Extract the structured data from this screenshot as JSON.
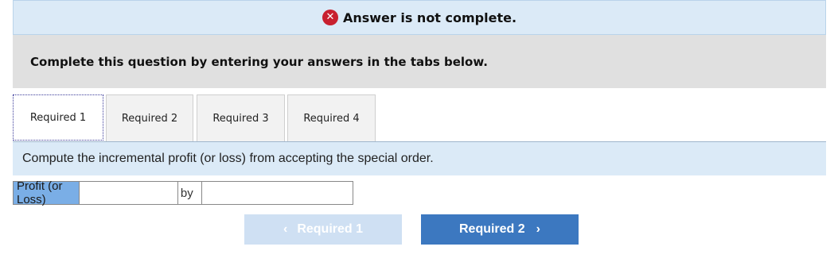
{
  "banner": {
    "icon": "error-x-icon",
    "text": "Answer is not complete."
  },
  "instructions": "Complete this question by entering your answers in the tabs below.",
  "tabs": [
    {
      "label": "Required 1",
      "active": true
    },
    {
      "label": "Required 2",
      "active": false
    },
    {
      "label": "Required 3",
      "active": false
    },
    {
      "label": "Required 4",
      "active": false
    }
  ],
  "prompt": "Compute the incremental profit (or loss) from accepting the special order.",
  "answer_row": {
    "label": "Profit (or Loss)",
    "value": "",
    "by_label": "by",
    "amount": ""
  },
  "nav": {
    "prev_label": "Required 1",
    "next_label": "Required 2",
    "prev_icon": "chevron-left-icon",
    "next_icon": "chevron-right-icon"
  },
  "colors": {
    "banner_bg": "#dbeaf7",
    "error_red": "#c8202f",
    "label_blue": "#7aaee6",
    "next_button": "#3c78c0",
    "prev_button_disabled": "#cfe0f3"
  }
}
